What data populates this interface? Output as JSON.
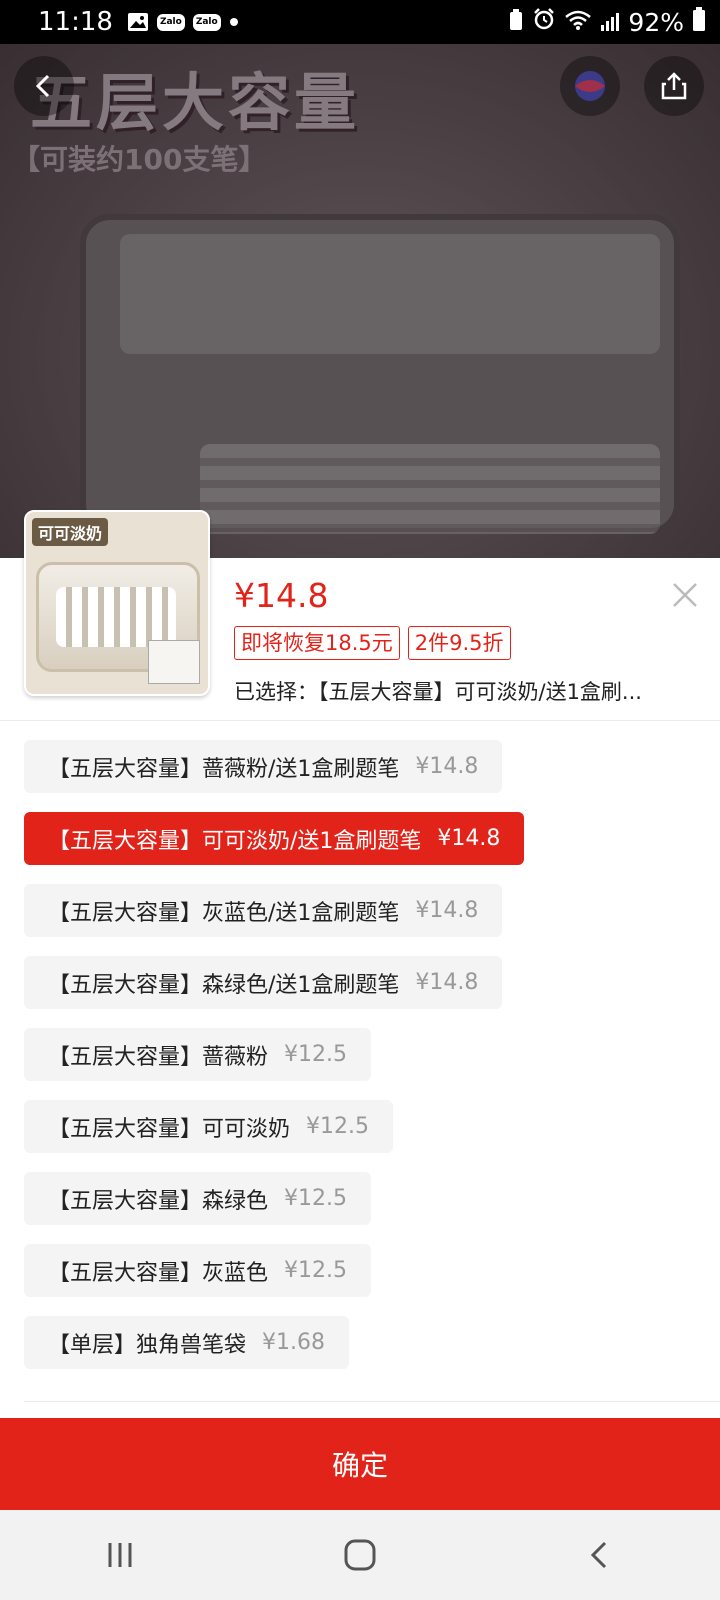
{
  "status_bar": {
    "time": "11:18",
    "zalo_1": "Zalo",
    "zalo_2": "Zalo",
    "battery": "92%"
  },
  "hero": {
    "headline": "五层大容量",
    "subline": "【可装约100支笔】"
  },
  "thumbnail": {
    "label": "可可淡奶"
  },
  "product": {
    "price": "¥14.8",
    "tags": [
      "即将恢复18.5元",
      "2件9.5折"
    ],
    "selected_text": "已选择：【五层大容量】可可淡奶/送1盒刷..."
  },
  "options": [
    {
      "name": "【五层大容量】蔷薇粉/送1盒刷题笔",
      "price": "¥14.8",
      "selected": false
    },
    {
      "name": "【五层大容量】可可淡奶/送1盒刷题笔",
      "price": "¥14.8",
      "selected": true
    },
    {
      "name": "【五层大容量】灰蓝色/送1盒刷题笔",
      "price": "¥14.8",
      "selected": false
    },
    {
      "name": "【五层大容量】森绿色/送1盒刷题笔",
      "price": "¥14.8",
      "selected": false
    },
    {
      "name": "【五层大容量】蔷薇粉",
      "price": "¥12.5",
      "selected": false
    },
    {
      "name": "【五层大容量】可可淡奶",
      "price": "¥12.5",
      "selected": false
    },
    {
      "name": "【五层大容量】森绿色",
      "price": "¥12.5",
      "selected": false
    },
    {
      "name": "【五层大容量】灰蓝色",
      "price": "¥12.5",
      "selected": false
    },
    {
      "name": "【单层】独角兽笔袋",
      "price": "¥1.68",
      "selected": false
    }
  ],
  "confirm_label": "确定",
  "colors": {
    "accent": "#e2231a",
    "option_bg": "#f4f4f4",
    "nav_bg": "#f2f2f2"
  },
  "icons": {
    "back": "chevron-left-icon",
    "globe": "globe-icon",
    "share": "share-icon",
    "close": "close-icon",
    "nav_recents": "recents-icon",
    "nav_home": "home-icon",
    "nav_back": "back-icon"
  }
}
